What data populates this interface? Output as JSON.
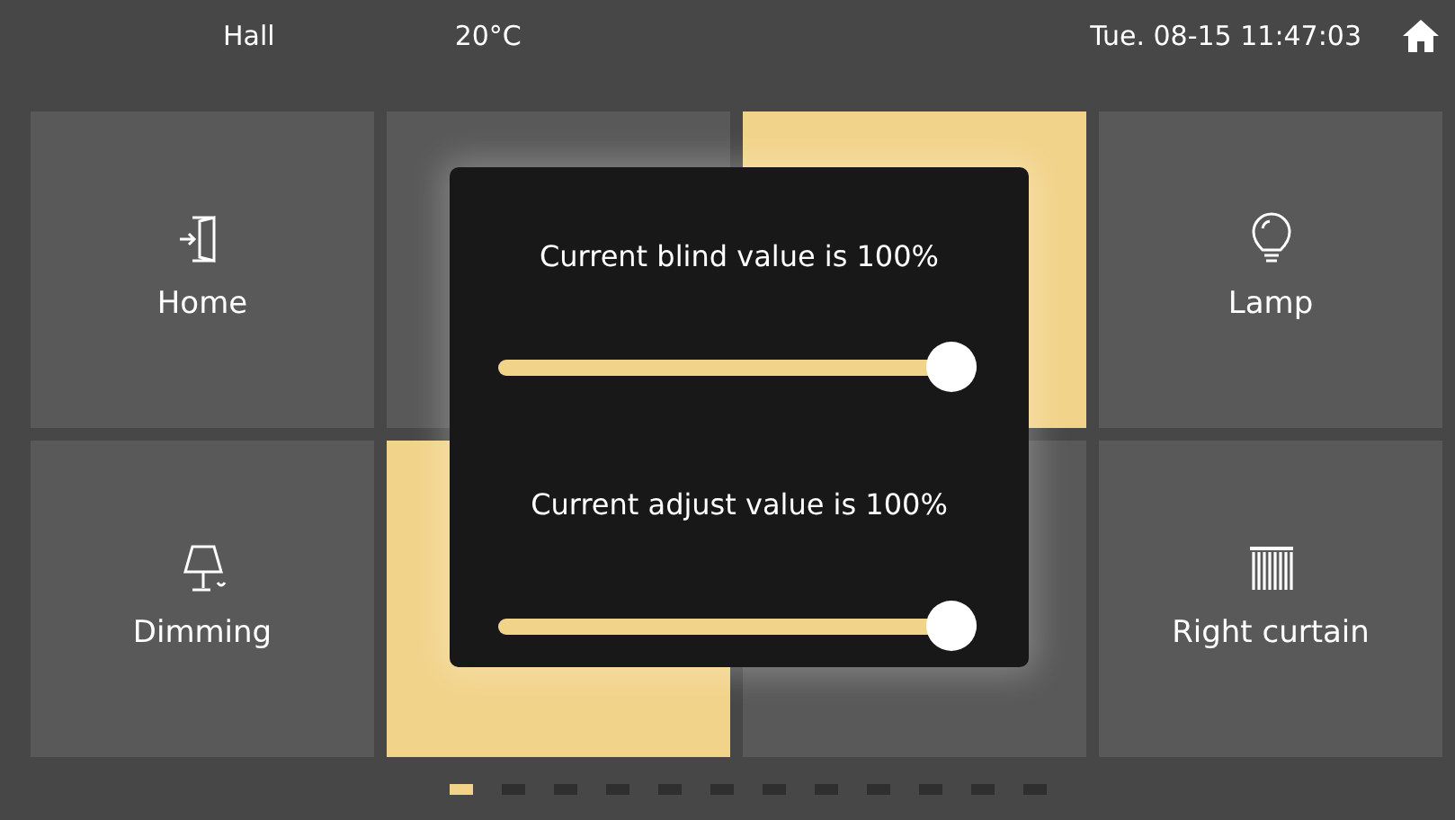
{
  "status_bar": {
    "room": "Hall",
    "temperature": "20°C",
    "datetime": "Tue. 08-15 11:47:03"
  },
  "tiles": [
    {
      "label": "Home",
      "selected": false
    },
    {
      "selected": false
    },
    {
      "selected": true
    },
    {
      "label": "Lamp",
      "selected": false
    },
    {
      "label": "Dimming",
      "selected": false
    },
    {
      "selected": true
    },
    {
      "selected": false
    },
    {
      "label": "Right curtain",
      "selected": false
    }
  ],
  "dialog": {
    "sliders": [
      {
        "label": "Current blind value is 100%",
        "level": 1
      },
      {
        "label": "Current adjust value is 100%",
        "level": 1
      }
    ]
  },
  "pages": [
    {
      "selected": true
    },
    {
      "selected": false
    },
    {
      "selected": false
    },
    {
      "selected": false
    },
    {
      "selected": false
    },
    {
      "selected": false
    },
    {
      "selected": false
    },
    {
      "selected": false
    },
    {
      "selected": false
    },
    {
      "selected": false
    },
    {
      "selected": false
    },
    {
      "selected": false
    }
  ]
}
